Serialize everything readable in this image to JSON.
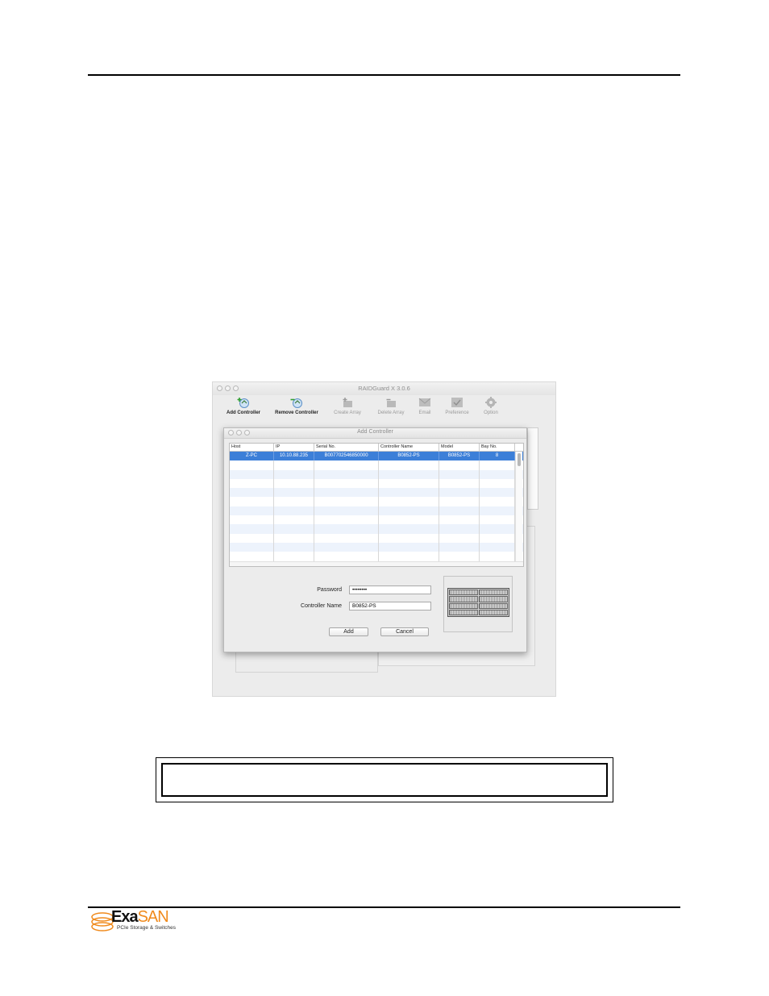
{
  "app": {
    "window_title": "RAIDGuard X 3.0.6",
    "toolbar": [
      {
        "label": "Add Controller",
        "icon": "add-controller-icon",
        "active": true
      },
      {
        "label": "Remove Controller",
        "icon": "remove-controller-icon",
        "active": true
      },
      {
        "label": "Create Array",
        "icon": "create-array-icon",
        "active": false
      },
      {
        "label": "Delete Array",
        "icon": "delete-array-icon",
        "active": false
      },
      {
        "label": "Email",
        "icon": "email-icon",
        "active": false
      },
      {
        "label": "Preference",
        "icon": "preference-icon",
        "active": false
      },
      {
        "label": "Option",
        "icon": "option-gear-icon",
        "active": false
      }
    ]
  },
  "dialog": {
    "title": "Add Controller",
    "columns": [
      "Host",
      "IP",
      "Serial No.",
      "Controller Name",
      "Model",
      "Bay No."
    ],
    "rows": [
      {
        "host": "Z-PC",
        "ip": "10.10.88.235",
        "serial": "B007702546850000",
        "name": "B0852-PS",
        "model": "B0852-PS",
        "bay": "8"
      }
    ],
    "password_label": "Password",
    "password_value": "••••••••",
    "controller_name_label": "Controller Name",
    "controller_name_value": "B0852-PS",
    "add_label": "Add",
    "cancel_label": "Cancel",
    "selection_color": "#3c7fd8"
  },
  "footer": {
    "logo_exa": "Exa",
    "logo_san": "SAN",
    "logo_tagline": "PCIe Storage & Switches",
    "brand_color": "#f08a1c"
  }
}
